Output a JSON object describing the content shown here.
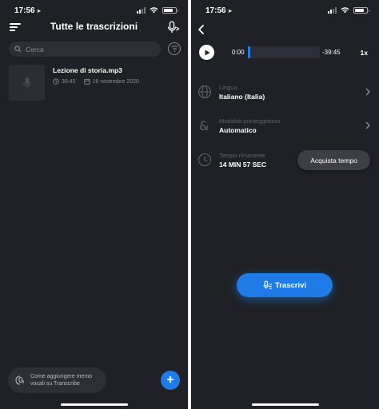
{
  "left_screen": {
    "status": {
      "time": "17:56"
    },
    "header": {
      "title": "Tutte le trascrizioni"
    },
    "search": {
      "placeholder": "Cerca"
    },
    "recordings": [
      {
        "title": "Lezione di storia.mp3",
        "duration": "39:45",
        "date": "16 novembre 2020"
      }
    ],
    "tip": {
      "text": "Come aggiungere memo vocali su Transcribe"
    },
    "fab": {
      "label": "+"
    }
  },
  "right_screen": {
    "status": {
      "time": "17:56"
    },
    "player": {
      "current_time": "0:00",
      "remaining_time": "-39:45",
      "speed": "1x",
      "progress": 0.0
    },
    "settings": {
      "language": {
        "label": "Lingua",
        "value": "Italiano (Italia)"
      },
      "punctuation": {
        "label": "Modalità punteggiatura",
        "value": "Automatico"
      },
      "time_left": {
        "label": "Tempo rimanente",
        "value": "14 MIN 57 SEC"
      }
    },
    "buy_time_label": "Acquista tempo",
    "transcribe_label": "Trascrivi"
  },
  "colors": {
    "background": "#1f2126",
    "accent": "#1f7be8",
    "surface": "#2d2f35",
    "muted_text": "#8a8d94"
  },
  "icons": [
    "menu-icon",
    "mic-record-icon",
    "search-icon",
    "filter-icon",
    "microphone-icon",
    "clock-icon",
    "calendar-icon",
    "voice-memo-icon",
    "plus-icon",
    "back-arrow-icon",
    "play-icon",
    "globe-icon",
    "ampersand-icon",
    "chevron-right-icon"
  ]
}
